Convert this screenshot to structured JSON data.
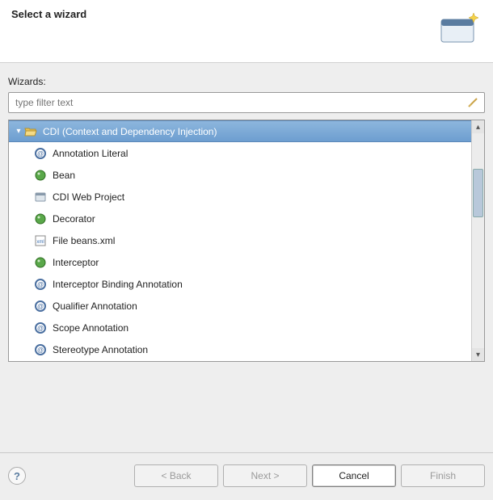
{
  "header": {
    "title": "Select a wizard"
  },
  "section_label": "Wizards:",
  "filter": {
    "placeholder": "type filter text"
  },
  "tree": {
    "root": {
      "label": "CDI (Context and Dependency Injection)",
      "selected": true,
      "expanded": true
    },
    "children": [
      {
        "icon": "annotation",
        "label": "Annotation Literal"
      },
      {
        "icon": "bean",
        "label": "Bean"
      },
      {
        "icon": "web",
        "label": "CDI Web Project"
      },
      {
        "icon": "bean",
        "label": "Decorator"
      },
      {
        "icon": "xml",
        "label": "File beans.xml"
      },
      {
        "icon": "bean",
        "label": "Interceptor"
      },
      {
        "icon": "annotation",
        "label": "Interceptor Binding Annotation"
      },
      {
        "icon": "annotation",
        "label": "Qualifier Annotation"
      },
      {
        "icon": "annotation",
        "label": "Scope Annotation"
      },
      {
        "icon": "annotation",
        "label": "Stereotype Annotation"
      }
    ]
  },
  "buttons": {
    "back": "< Back",
    "next": "Next >",
    "cancel": "Cancel",
    "finish": "Finish"
  }
}
